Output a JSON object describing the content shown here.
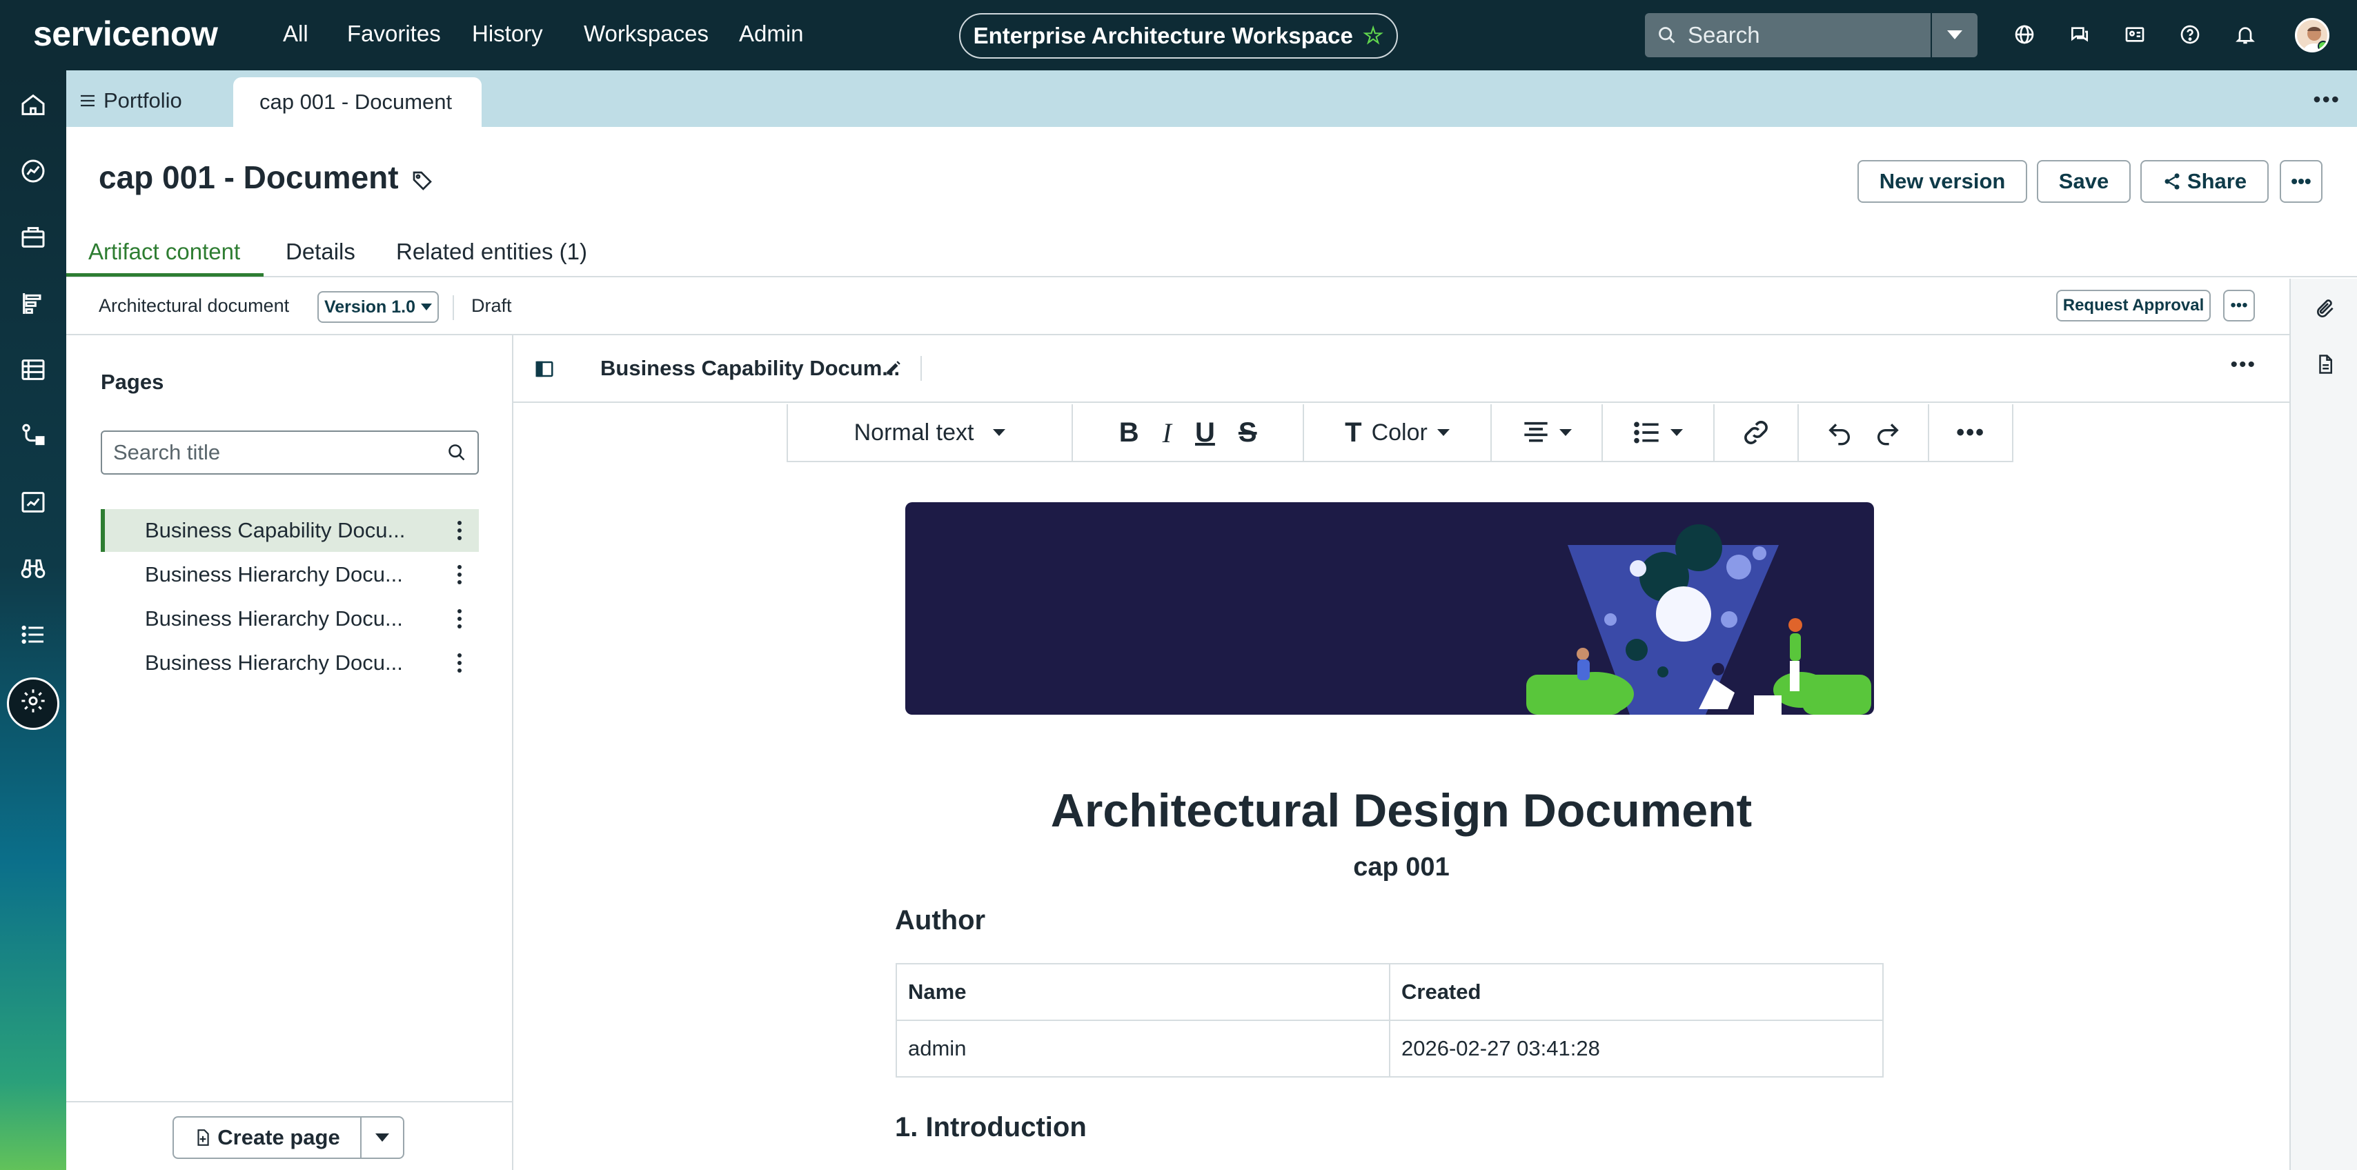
{
  "brand": {
    "name_service": "service",
    "name_now": "now"
  },
  "nav": [
    "All",
    "Favorites",
    "History",
    "Workspaces",
    "Admin"
  ],
  "workspace": {
    "label": "Enterprise Architecture Workspace"
  },
  "search": {
    "placeholder": "Search"
  },
  "header_icons": [
    "globe-icon",
    "chat-icon",
    "contact-card-icon",
    "help-icon",
    "bell-icon"
  ],
  "rail_icons": [
    "home-icon",
    "dashboard-icon",
    "briefcase-icon",
    "roadmap-icon",
    "list-view-icon",
    "process-flow-icon",
    "analytics-icon",
    "binoculars-icon",
    "list-icon",
    "settings-icon"
  ],
  "tabs": [
    {
      "label": "Portfolio"
    },
    {
      "label": "cap 001 - Document"
    }
  ],
  "page": {
    "title": "cap 001 - Document"
  },
  "actions": {
    "new_version": "New version",
    "save": "Save",
    "share": "Share"
  },
  "artifact_tabs": [
    "Artifact content",
    "Details",
    "Related entities (1)"
  ],
  "meta": {
    "type": "Architectural document",
    "version": "Version 1.0",
    "status": "Draft",
    "request_approval": "Request Approval"
  },
  "pages_panel": {
    "title": "Pages",
    "search_placeholder": "Search title",
    "items": [
      "Business Capability Docu...",
      "Business Hierarchy Docu...",
      "Business Hierarchy Docu...",
      "Business Hierarchy Docu..."
    ],
    "selected_index": 0,
    "create_label": "Create page"
  },
  "editor": {
    "doc_name": "Business Capability Docum...",
    "toolbar": {
      "text_style": "Normal text",
      "color": "Color"
    }
  },
  "document": {
    "title": "Architectural Design Document",
    "subtitle": "cap 001",
    "author_heading": "Author",
    "author_table": {
      "headers": [
        "Name",
        "Created"
      ],
      "rows": [
        [
          "admin",
          "2026-02-27 03:41:28"
        ]
      ]
    },
    "intro_heading": "1. Introduction"
  },
  "colors": {
    "header_bg": "#0e2b35",
    "tabstrip_bg": "#bfdde6",
    "accent_green": "#2e7d32",
    "banner_bg": "#1d1b46"
  }
}
